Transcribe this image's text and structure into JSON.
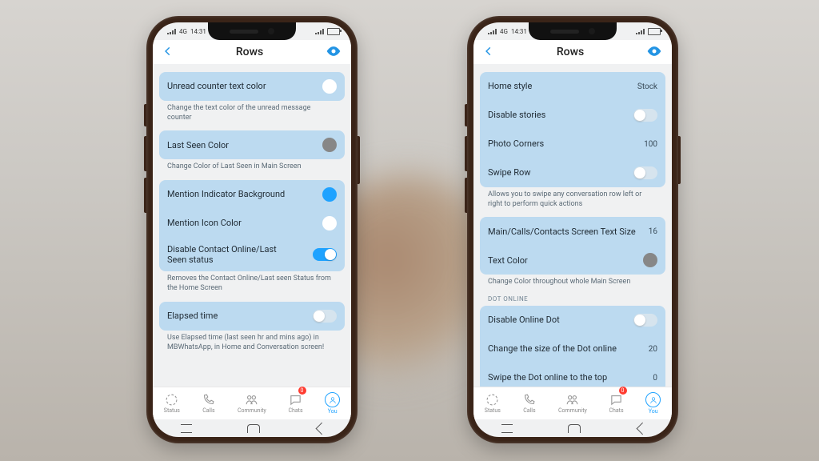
{
  "status": {
    "time": "14:31",
    "net": "4G"
  },
  "header": {
    "title": "Rows"
  },
  "tabs": {
    "status": "Status",
    "calls": "Calls",
    "community": "Community",
    "chats": "Chats",
    "you": "You",
    "chats_badge": "0"
  },
  "left": {
    "g1": {
      "r1": {
        "label": "Unread counter text color"
      },
      "desc": "Change the text color of the unread message counter"
    },
    "g2": {
      "r1": {
        "label": "Last Seen Color"
      },
      "desc": "Change Color of Last Seen in Main Screen"
    },
    "g3": {
      "r1": {
        "label": "Mention Indicator Background"
      },
      "r2": {
        "label": "Mention Icon Color"
      },
      "r3": {
        "label": "Disable Contact Online/Last Seen status"
      },
      "desc": "Removes the Contact Online/Last seen Status from the Home Screen"
    },
    "g4": {
      "r1": {
        "label": "Elapsed time"
      },
      "desc": "Use Elapsed time (last seen hr and mins ago) in MBWhatsApp, in Home and Conversation screen!"
    }
  },
  "right": {
    "g1": {
      "r1": {
        "label": "Home style",
        "value": "Stock"
      },
      "r2": {
        "label": "Disable stories"
      },
      "r3": {
        "label": "Photo Corners",
        "value": "100"
      },
      "r4": {
        "label": "Swipe Row"
      },
      "desc": "Allows you to swipe any conversation row left or right to perform quick actions"
    },
    "g2": {
      "r1": {
        "label": "Main/Calls/Contacts Screen Text Size",
        "value": "16"
      },
      "r2": {
        "label": "Text Color"
      },
      "desc": "Change Color throughout whole Main Screen"
    },
    "section": "DOT ONLINE",
    "g3": {
      "r1": {
        "label": "Disable Online Dot"
      },
      "r2": {
        "label": "Change the size of the Dot online",
        "value": "20"
      },
      "r3": {
        "label": "Swipe the Dot online to the top",
        "value": "0"
      }
    }
  }
}
